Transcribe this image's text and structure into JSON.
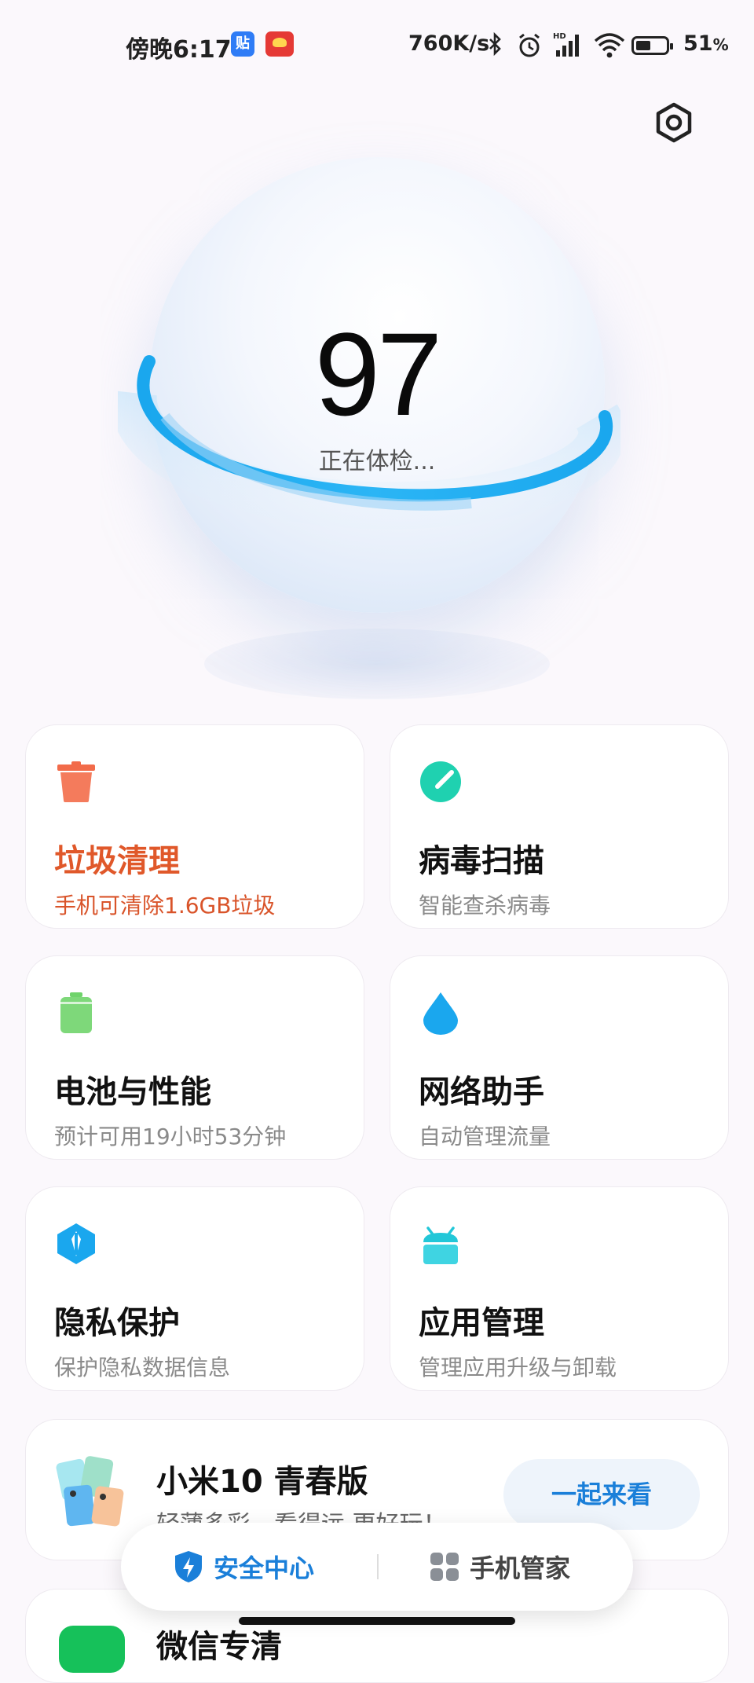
{
  "status_bar": {
    "time": "傍晚6:17",
    "app_badge_1": "贴",
    "net_speed": "760K/s",
    "battery_percent": "51",
    "battery_unit": "%",
    "battery_level": 0.51
  },
  "icons": {
    "settings": "hexagon-settings-icon",
    "bluetooth": "bluetooth-icon",
    "alarm": "alarm-icon",
    "signal": "signal-hd-icon",
    "wifi": "wifi-icon"
  },
  "hero": {
    "score": "97",
    "status": "正在体检..."
  },
  "cards": [
    {
      "title": "垃圾清理",
      "subtitle": "手机可清除1.6GB垃圾",
      "icon": "trash-icon",
      "color": "#f26b4a"
    },
    {
      "title": "病毒扫描",
      "subtitle": "智能查杀病毒",
      "icon": "scan-gauge-icon",
      "color": "#1fd1b0"
    },
    {
      "title": "电池与性能",
      "subtitle": "预计可用19小时53分钟",
      "icon": "battery-icon",
      "color": "#6fd36b"
    },
    {
      "title": "网络助手",
      "subtitle": "自动管理流量",
      "icon": "droplet-icon",
      "color": "#1aa7ee"
    },
    {
      "title": "隐私保护",
      "subtitle": "保护隐私数据信息",
      "icon": "privacy-hexagon-icon",
      "color": "#1aa7ee"
    },
    {
      "title": "应用管理",
      "subtitle": "管理应用升级与卸载",
      "icon": "android-app-icon",
      "color": "#22c7d8"
    }
  ],
  "promo": {
    "title": "小米10 青春版",
    "subtitle": "轻薄多彩，看得远 更好玩！",
    "button": "一起来看"
  },
  "next_card": {
    "title": "微信专清"
  },
  "bottom_nav": {
    "security": "安全中心",
    "manager": "手机管家"
  },
  "colors": {
    "accent_blue": "#1a7fd9",
    "warning_orange": "#e0582a",
    "ring_blue": "#19a3f0"
  }
}
